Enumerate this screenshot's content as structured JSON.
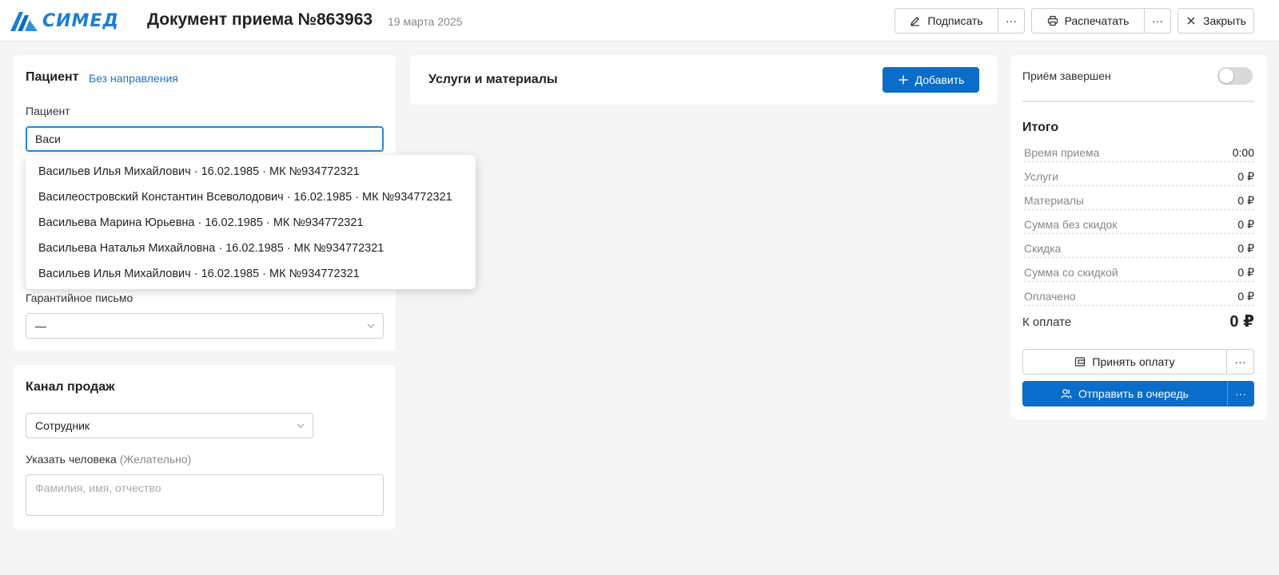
{
  "header": {
    "brand": "СИМЕД",
    "title": "Документ приема №863963",
    "date": "19 марта 2025",
    "sign_label": "Подписать",
    "print_label": "Распечатать",
    "close_label": "Закрыть",
    "more_label": "···"
  },
  "patient": {
    "section_title": "Пациент",
    "referral_link": "Без направления",
    "field_label": "Пациент",
    "field_value": "Васи",
    "suggestions": [
      "Васильев Илья Михайлович · 16.02.1985 · МК №934772321",
      "Василеостровский Константин Всеволодович · 16.02.1985 · МК №934772321",
      "Васильева Марина Юрьевна · 16.02.1985 · МК №934772321",
      "Васильева Наталья Михайловна · 16.02.1985 · МК №934772321",
      "Васильев Илья Михайлович · 16.02.1985 · МК №934772321"
    ],
    "guarantee_label": "Гарантийное письмо",
    "guarantee_value": "—"
  },
  "sales": {
    "section_title": "Канал продаж",
    "channel_value": "Сотрудник",
    "person_label": "Указать человека",
    "person_hint": "(Желательно)",
    "person_placeholder": "Фамилия, имя, отчество"
  },
  "services": {
    "title": "Услуги и материалы",
    "add_label": "Добавить"
  },
  "summary": {
    "completed_label": "Приём завершен",
    "completed": false,
    "total_title": "Итого",
    "rows": [
      {
        "label": "Время приема",
        "value": "0:00"
      },
      {
        "label": "Услуги",
        "value": "0 ₽"
      },
      {
        "label": "Материалы",
        "value": "0 ₽"
      },
      {
        "label": "Сумма без скидок",
        "value": "0 ₽"
      },
      {
        "label": "Скидка",
        "value": "0 ₽"
      },
      {
        "label": "Сумма со скидкой",
        "value": "0 ₽"
      },
      {
        "label": "Оплачено",
        "value": "0 ₽"
      }
    ],
    "to_pay_label": "К оплате",
    "to_pay_value": "0 ₽",
    "accept_payment_label": "Принять оплату",
    "send_queue_label": "Отправить в очередь",
    "more_label": "···"
  },
  "colors": {
    "accent": "#0a6dc9",
    "link": "#1f72c4",
    "brand": "#1a7fd4"
  }
}
